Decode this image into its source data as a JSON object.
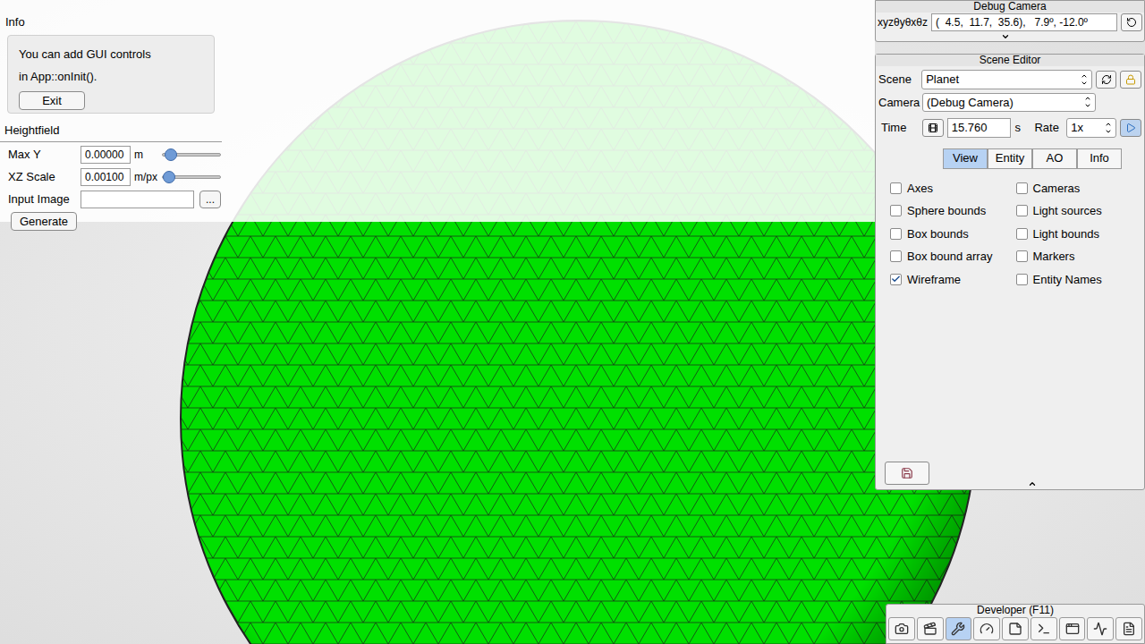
{
  "info_panel": {
    "title": "Info",
    "lines": [
      "You can add GUI controls",
      "in App::onInit()."
    ],
    "button": "Exit"
  },
  "heightfield_panel": {
    "title": "Heightfield",
    "rows": [
      {
        "kind": "slider",
        "label": "Max Y",
        "value": "0.00000",
        "unit": "m",
        "level": 0.05
      },
      {
        "kind": "slider",
        "label": "XZ Scale",
        "value": "0.00100",
        "unit": "m/px",
        "level": 0.02
      },
      {
        "kind": "file",
        "label": "Input Image",
        "value": "",
        "button": "..."
      }
    ],
    "button": "Generate"
  },
  "debug_camera": {
    "title": "Debug Camera",
    "label": "xyzθyθxθz",
    "value": "(  4.5,  11.7,  35.6),   7.9º, -12.0º"
  },
  "scene_editor": {
    "title": "Scene Editor",
    "scene": {
      "label": "Scene",
      "value": "Planet"
    },
    "camera": {
      "label": "Camera",
      "value": "(Debug Camera)"
    },
    "time": {
      "label": "Time",
      "value": "15.760",
      "unit": "s"
    },
    "rate": {
      "label": "Rate",
      "value": "1x"
    },
    "tabs": [
      {
        "label": "View",
        "selected": true
      },
      {
        "label": "Entity",
        "selected": false
      },
      {
        "label": "AO",
        "selected": false
      },
      {
        "label": "Info",
        "selected": false
      }
    ],
    "checkboxes": [
      {
        "label": "Axes",
        "checked": false
      },
      {
        "label": "Cameras",
        "checked": false
      },
      {
        "label": "Sphere bounds",
        "checked": false
      },
      {
        "label": "Light sources",
        "checked": false
      },
      {
        "label": "Box bounds",
        "checked": false
      },
      {
        "label": "Light bounds",
        "checked": false
      },
      {
        "label": "Box bound array",
        "checked": false
      },
      {
        "label": "Markers",
        "checked": false
      },
      {
        "label": "Wireframe",
        "checked": true
      },
      {
        "label": "Entity Names",
        "checked": false
      }
    ]
  },
  "developer": {
    "title": "Developer (F11)",
    "tools": [
      {
        "selected": false
      },
      {
        "selected": false
      },
      {
        "selected": true
      },
      {
        "selected": false
      },
      {
        "selected": false
      },
      {
        "selected": false
      },
      {
        "selected": false
      },
      {
        "selected": false
      },
      {
        "selected": false
      }
    ]
  },
  "viewport": {
    "sphere_color": "#00e000",
    "wireframe": true
  }
}
